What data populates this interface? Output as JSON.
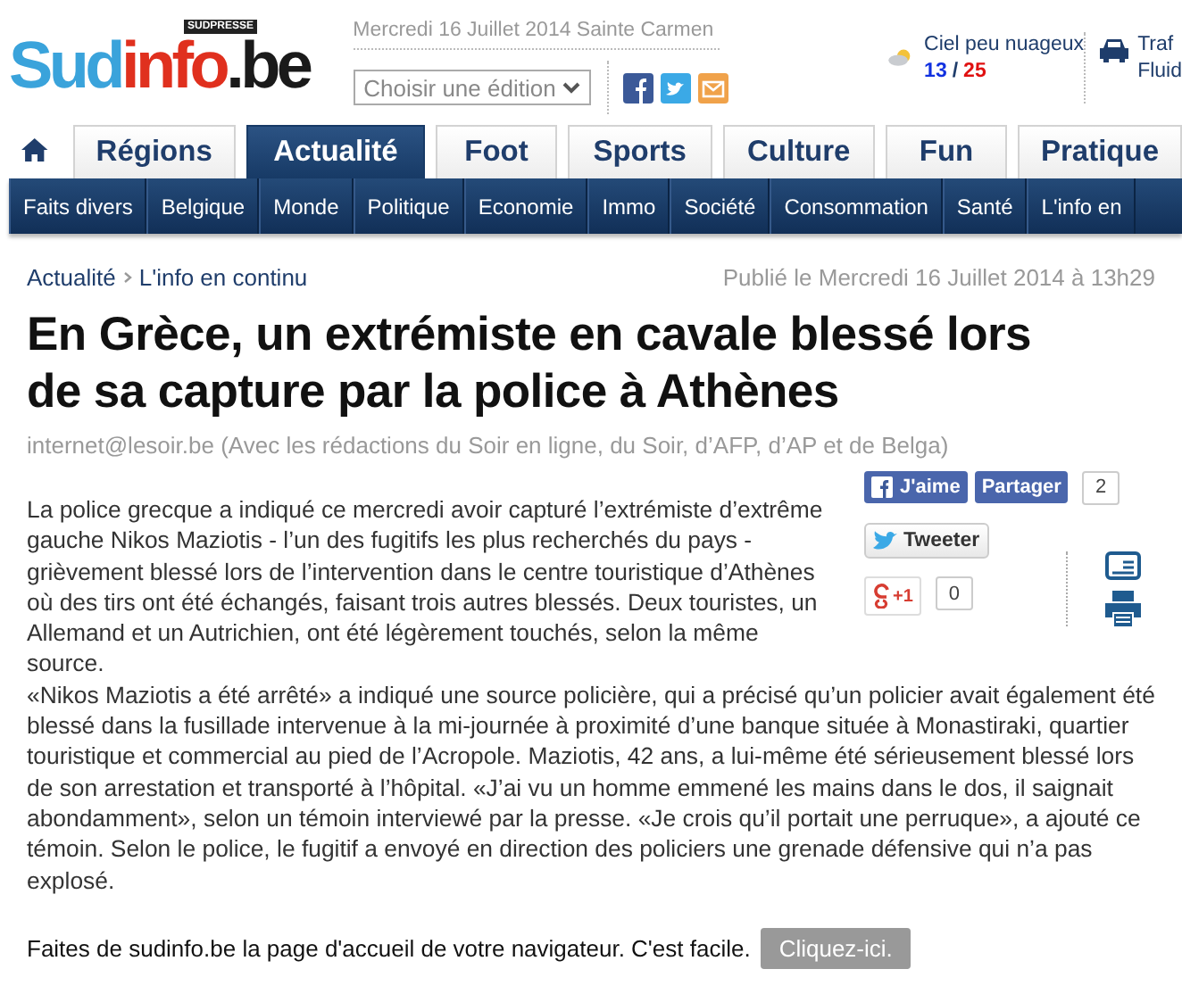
{
  "header": {
    "logo": {
      "badge": "SUDPRESSE",
      "parts": [
        {
          "text": "Sud",
          "color": "#3aa3db"
        },
        {
          "text": "info",
          "color": "#e0301e"
        },
        {
          "text": ".be",
          "color": "#1a1a1a"
        }
      ]
    },
    "date": "Mercredi 16 Juillet 2014 Sainte Carmen",
    "edition_select": {
      "value": "Choisir une édition"
    },
    "weather": {
      "label": "Ciel peu nuageux",
      "low": "13",
      "separator": "/",
      "high": "25"
    },
    "traffic": {
      "label": "Traf",
      "status": "Fluid"
    }
  },
  "tabs": [
    {
      "label": "Régions",
      "selected": false
    },
    {
      "label": "Actualité",
      "selected": true
    },
    {
      "label": "Foot",
      "selected": false
    },
    {
      "label": "Sports",
      "selected": false
    },
    {
      "label": "Culture",
      "selected": false
    },
    {
      "label": "Fun",
      "selected": false
    },
    {
      "label": "Pratique",
      "selected": false
    }
  ],
  "subnav": [
    "Faits divers",
    "Belgique",
    "Monde",
    "Politique",
    "Economie",
    "Immo",
    "Société",
    "Consommation",
    "Santé",
    "L'info en"
  ],
  "breadcrumb": [
    "Actualité",
    "L'info en continu"
  ],
  "published": "Publié le Mercredi 16 Juillet 2014 à 13h29",
  "title": "En Grèce, un extrémiste en cavale blessé lors de sa capture par la police à Athènes",
  "author": "internet@lesoir.be (Avec les rédactions du Soir en ligne, du Soir, d’AFP, d’AP et de Belga)",
  "share": {
    "like": "J'aime",
    "share": "Partager",
    "share_count": "2",
    "tweet": "Tweeter",
    "gplus": "+1",
    "gplus_count": "0"
  },
  "body": [
    "La police grecque a indiqué ce mercredi avoir capturé l’extrémiste d’extrême gauche Nikos Maziotis - l’un des fugitifs les plus recherchés du pays - grièvement blessé lors de l’intervention dans le centre touristique d’Athènes où des tirs ont été échangés, faisant trois autres blessés. Deux touristes, un Allemand et un Autrichien, ont été légèrement touchés, selon la même source.",
    "«Nikos Maziotis a été arrêté» a indiqué une source policière, qui a précisé qu’un policier avait également été blessé dans la fusillade intervenue à la mi-journée à proximité d’une banque située à Monastiraki, quartier touristique et commercial au pied de l’Acropole. Maziotis, 42 ans, a lui-même été sérieusement blessé lors de son arrestation et transporté à l’hôpital. «J’ai vu un homme emmené les mains dans le dos, il saignait abondamment», selon un témoin interviewé par la presse. «Je crois qu’il portait une perruque», a ajouté ce témoin. Selon le police, le fugitif a envoyé en direction des policiers une grenade défensive qui n’a pas explosé."
  ],
  "homepage_prompt": {
    "text": "Faites de sudinfo.be la page d'accueil de votre navigateur. C'est facile.",
    "button": "Cliquez-ici."
  }
}
